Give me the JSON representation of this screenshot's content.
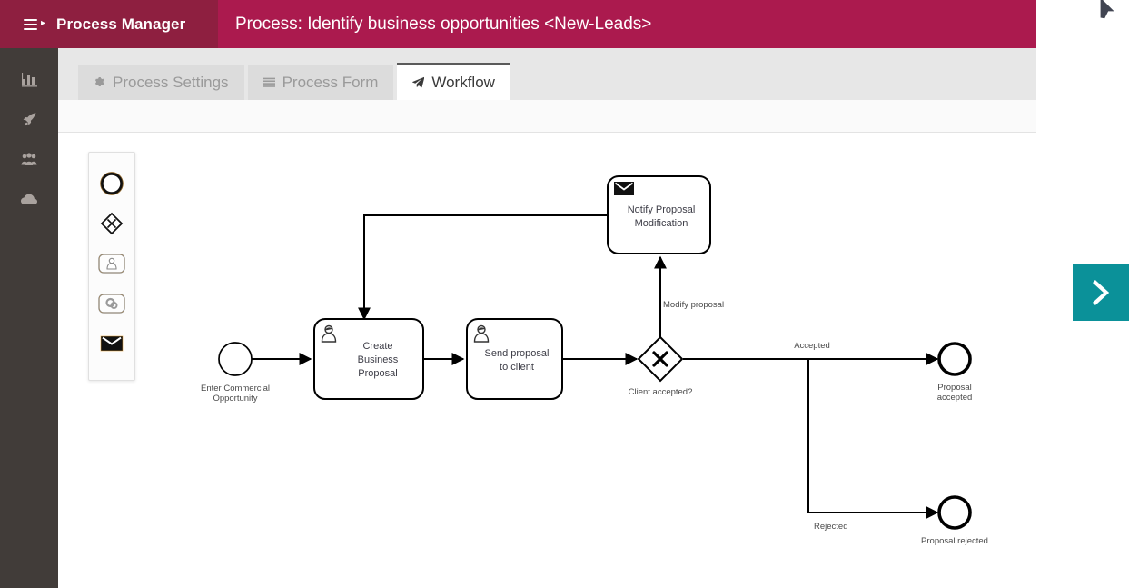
{
  "header": {
    "menu_icon": "hamburger-icon",
    "brand": "Process Manager",
    "title": "Process: Identify business opportunities <New-Leads>",
    "bg_left": "#8e1f40",
    "bg_right": "#ab1a4e"
  },
  "rail": {
    "items": [
      {
        "icon": "chart-bar-icon",
        "label": "Dashboard"
      },
      {
        "icon": "rocket-icon",
        "label": "Processes"
      },
      {
        "icon": "users-group-icon",
        "label": "Teams"
      },
      {
        "icon": "cloud-icon",
        "label": "Cloud"
      }
    ]
  },
  "tabs": [
    {
      "label": "Process Settings",
      "icon": "gear-icon",
      "active": false
    },
    {
      "label": "Process Form",
      "icon": "list-icon",
      "active": false
    },
    {
      "label": "Workflow",
      "icon": "paper-plane-icon",
      "active": true
    }
  ],
  "palette": {
    "items": [
      {
        "icon": "start-event-circle-icon",
        "label": "Start Event"
      },
      {
        "icon": "exclusive-gateway-diamond-icon",
        "label": "Gateway"
      },
      {
        "icon": "user-task-icon",
        "label": "User Task"
      },
      {
        "icon": "service-task-icon",
        "label": "Service Task"
      },
      {
        "icon": "message-event-envelope-icon",
        "label": "Message Task"
      }
    ]
  },
  "diagram": {
    "nodes": [
      {
        "id": "start",
        "type": "start-event",
        "label": "Enter Commercial\nOpportunity",
        "label_line1": "Enter Commercial",
        "label_line2": "Opportunity"
      },
      {
        "id": "task-create",
        "type": "user-task",
        "label_line1": "Create",
        "label_line2": "Business",
        "label_line3": "Proposal"
      },
      {
        "id": "task-send",
        "type": "user-task",
        "label_line1": "Send proposal",
        "label_line2": "to client"
      },
      {
        "id": "gateway",
        "type": "exclusive-gateway",
        "label": "Client accepted?",
        "symbol": "X"
      },
      {
        "id": "task-notify",
        "type": "message-task",
        "label_line1": "Notify Proposal",
        "label_line2": "Modification"
      },
      {
        "id": "end-accepted",
        "type": "end-event",
        "label_line1": "Proposal",
        "label_line2": "accepted"
      },
      {
        "id": "end-rejected",
        "type": "end-event",
        "label_line1": "Proposal rejected"
      }
    ],
    "flows": [
      {
        "id": "flow-modify",
        "label": "Modify proposal"
      },
      {
        "id": "flow-accepted",
        "label": "Accepted"
      },
      {
        "id": "flow-rejected",
        "label": "Rejected"
      }
    ]
  },
  "next_button": {
    "icon": "chevron-right-icon",
    "color": "#0b9199"
  }
}
